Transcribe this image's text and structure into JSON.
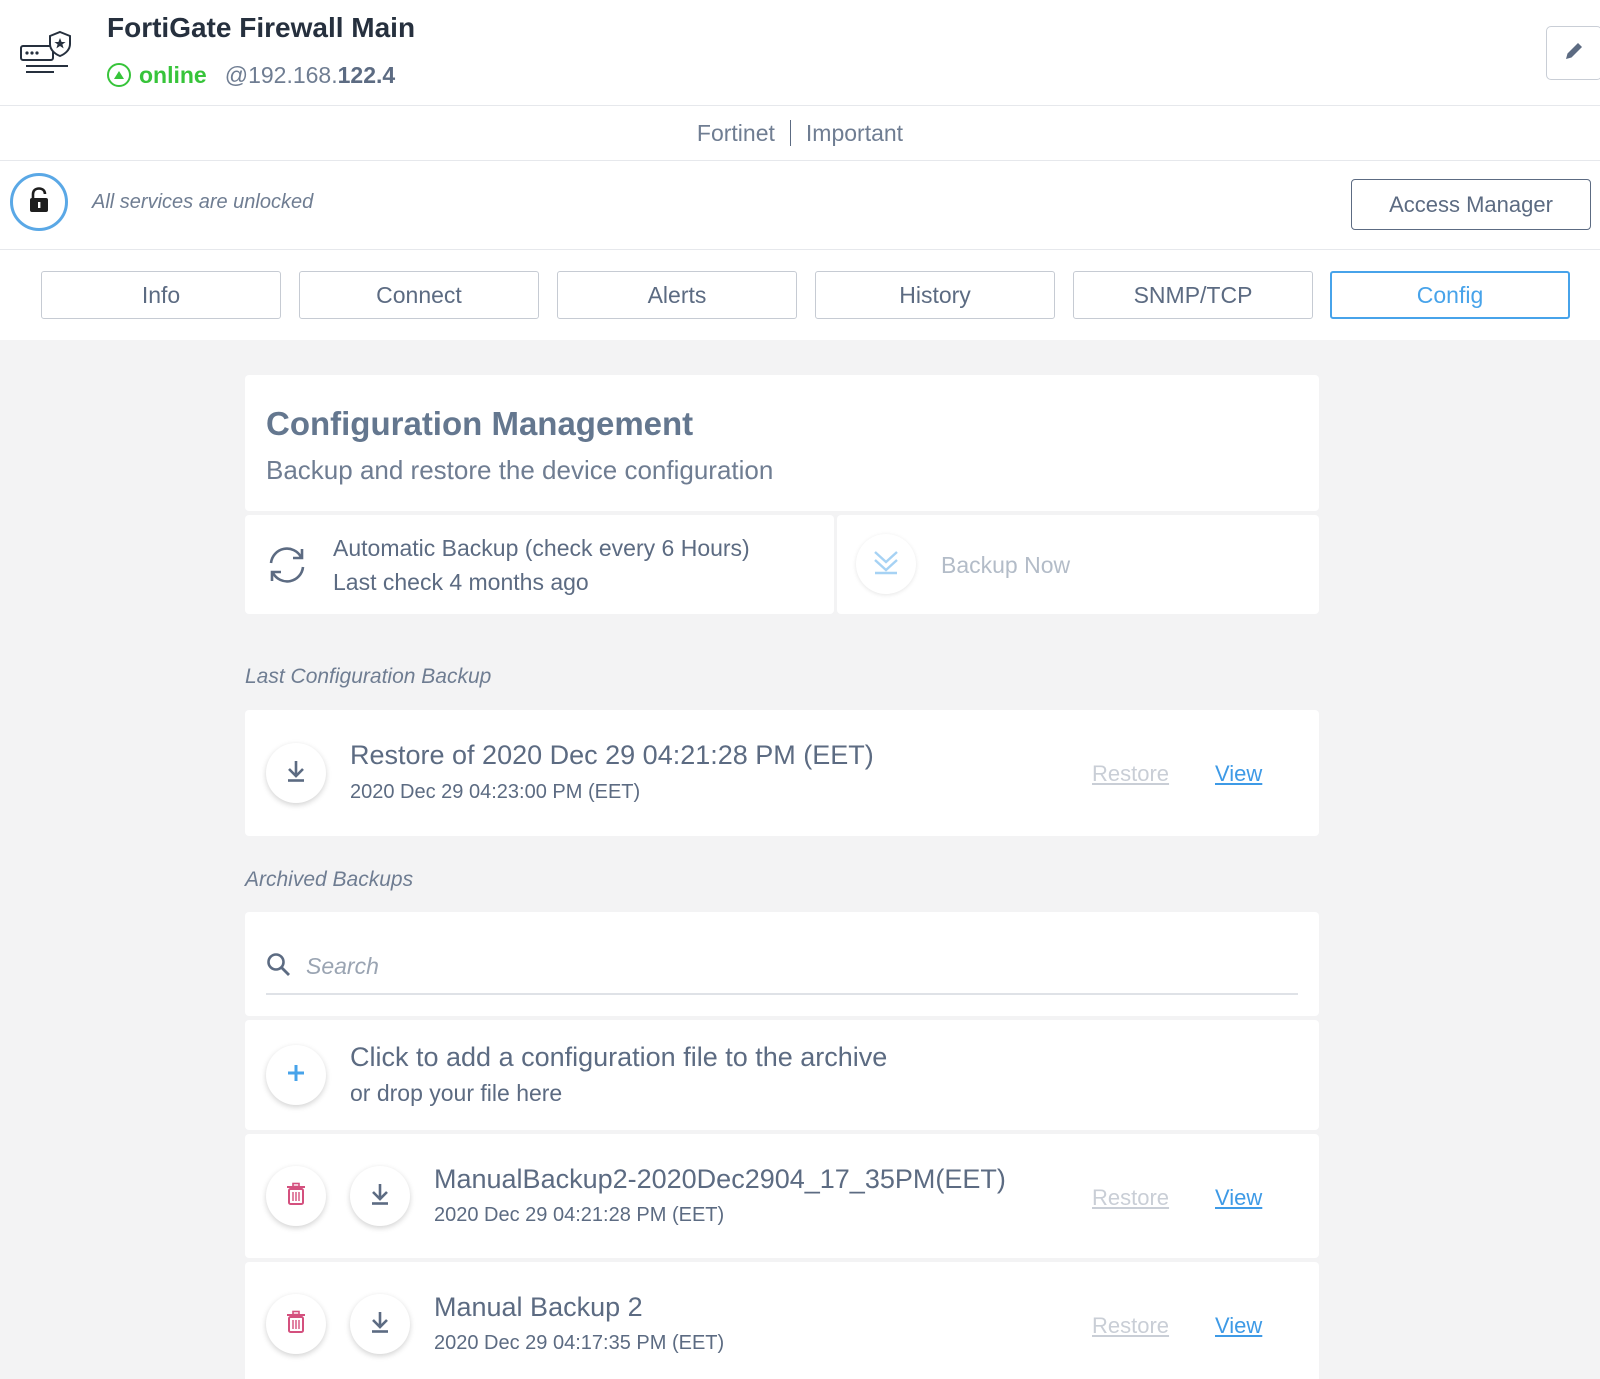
{
  "device": {
    "title": "FortiGate Firewall Main",
    "status": "online",
    "ip_prefix": "@192.168.",
    "ip_suffix": "122.4"
  },
  "tags": {
    "vendor": "Fortinet",
    "priority": "Important"
  },
  "lock": {
    "text": "All services are unlocked",
    "access_button": "Access Manager"
  },
  "tabs": [
    {
      "label": "Info"
    },
    {
      "label": "Connect"
    },
    {
      "label": "Alerts"
    },
    {
      "label": "History"
    },
    {
      "label": "SNMP/TCP"
    },
    {
      "label": "Config",
      "active": true
    }
  ],
  "config": {
    "title": "Configuration Management",
    "subtitle": "Backup and restore the device configuration",
    "auto_backup": {
      "title": "Automatic Backup (check every 6 Hours)",
      "last_check": "Last check 4 months ago"
    },
    "backup_now": "Backup Now"
  },
  "last_backup": {
    "section_label": "Last Configuration Backup",
    "title": "Restore of 2020 Dec 29 04:21:28 PM (EET)",
    "date": "2020 Dec 29 04:23:00 PM (EET)",
    "restore_label": "Restore",
    "view_label": "View"
  },
  "archived": {
    "section_label": "Archived Backups",
    "search_placeholder": "Search",
    "add": {
      "title": "Click to add a configuration file to the archive",
      "subtitle": "or drop your file here"
    },
    "items": [
      {
        "name": "ManualBackup2-2020Dec2904_17_35PM(EET)",
        "date": "2020 Dec 29 04:21:28 PM (EET)",
        "restore_label": "Restore",
        "view_label": "View"
      },
      {
        "name": "Manual Backup 2",
        "date": "2020 Dec 29 04:17:35 PM (EET)",
        "restore_label": "Restore",
        "view_label": "View"
      }
    ]
  },
  "colors": {
    "online": "#37c43a",
    "accent": "#47a3ea",
    "link": "#3e9ae6",
    "text": "#5c6b82",
    "trash": "#d4507e",
    "background": "#f3f3f4"
  },
  "icons": {
    "device": "firewall-device-icon",
    "status": "online-status-icon",
    "edit": "pencil-icon",
    "lock": "unlocked-padlock-icon",
    "sync": "sync-icon",
    "backup_now": "double-chevron-down-icon",
    "download": "download-icon",
    "search": "search-icon",
    "add": "plus-icon",
    "delete": "trash-icon"
  }
}
